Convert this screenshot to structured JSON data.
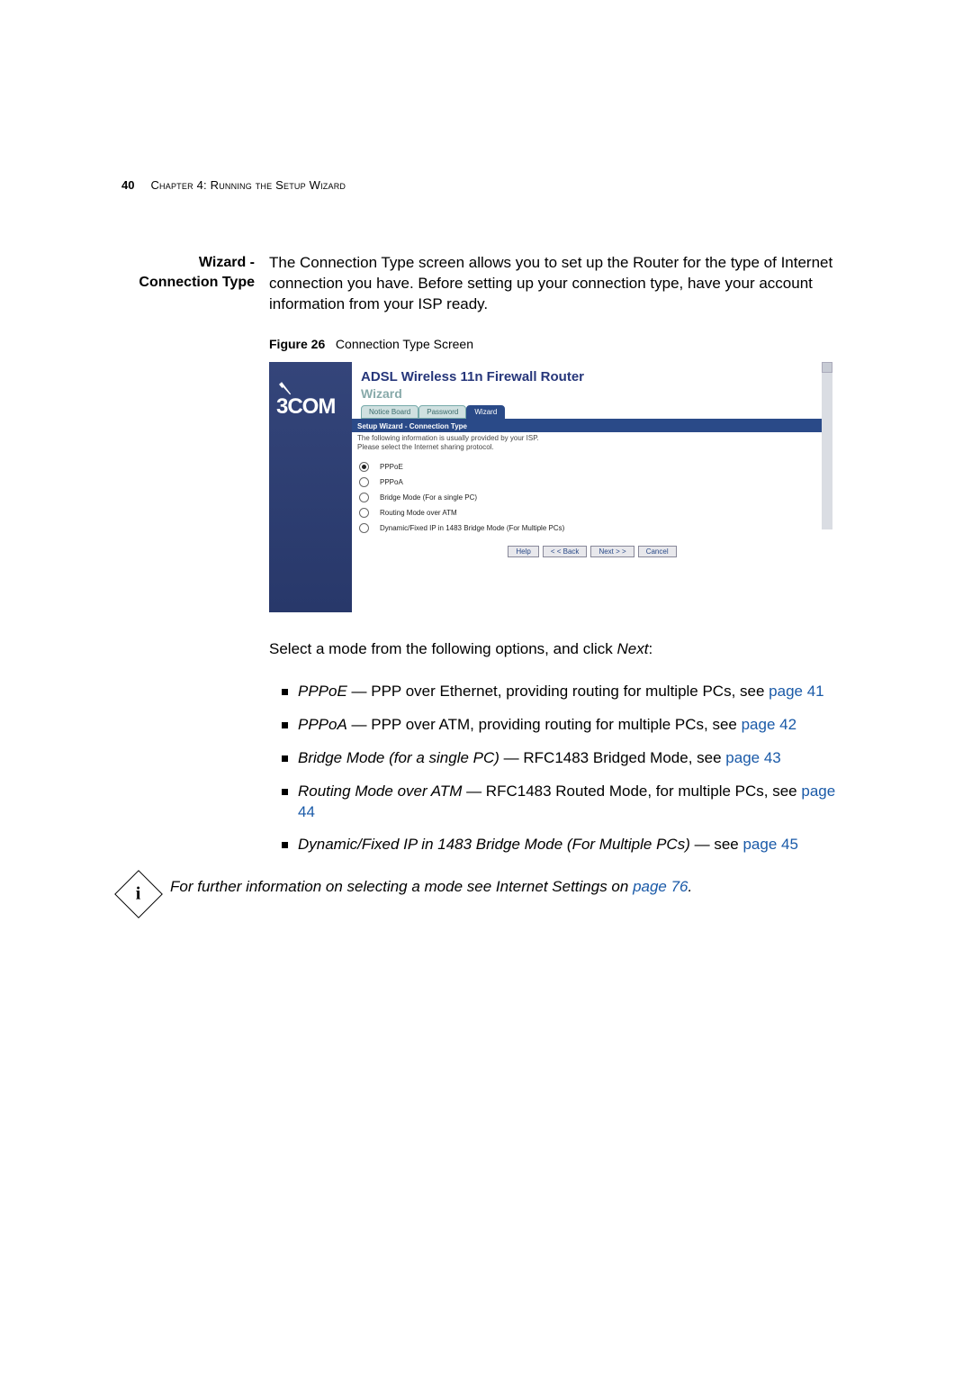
{
  "pageNumber": "40",
  "runningTitle": "Chapter 4: Running the Setup Wizard",
  "sideHeading": "Wizard - Connection Type",
  "introPara": "The Connection Type screen allows you to set up the Router for the type of Internet connection you have. Before setting up your connection type, have your account information from your ISP ready.",
  "figure": {
    "labelPrefix": "Figure 26",
    "labelText": "Connection Type Screen",
    "brand": "3COM",
    "logoGlyph": "ܢ",
    "title": "ADSL Wireless 11n Firewall Router",
    "subtitle": "Wizard",
    "tabs": [
      "Notice Board",
      "Password",
      "Wizard"
    ],
    "activeTabIndex": 2,
    "panelTitle": "Setup Wizard - Connection Type",
    "panelDesc1": "The following information is usually provided by your ISP.",
    "panelDesc2": "Please select the Internet sharing protocol.",
    "radios": [
      {
        "label": "PPPoE",
        "selected": true
      },
      {
        "label": "PPPoA",
        "selected": false
      },
      {
        "label": "Bridge Mode (For a single PC)",
        "selected": false
      },
      {
        "label": "Routing Mode over ATM",
        "selected": false
      },
      {
        "label": "Dynamic/Fixed IP in 1483 Bridge Mode (For Multiple PCs)",
        "selected": false
      }
    ],
    "buttons": [
      "Help",
      "< < Back",
      "Next > >",
      "Cancel"
    ]
  },
  "selectPara_a": "Select a mode from the following options, and click ",
  "selectPara_next": "Next",
  "selectPara_b": ":",
  "options": [
    {
      "em": "PPPoE",
      "dash": " — PPP over Ethernet, providing routing for multiple PCs, see ",
      "link": "page 41"
    },
    {
      "em": "PPPoA",
      "dash": " — PPP over ATM, providing routing for multiple PCs, see ",
      "link": "page 42"
    },
    {
      "em": "Bridge Mode (for a single PC)",
      "dash": " — RFC1483 Bridged Mode, see ",
      "link": "page 43"
    },
    {
      "em": "Routing Mode over ATM",
      "dash": " — RFC1483 Routed Mode, for multiple PCs, see ",
      "link": "page 44"
    },
    {
      "em": "Dynamic/Fixed IP in 1483 Bridge Mode (For Multiple PCs)",
      "dash": " — see ",
      "link": "page 45"
    }
  ],
  "infoText_a": "For further information on selecting a mode see Internet Settings on ",
  "infoLink": "page 76",
  "infoText_b": "."
}
